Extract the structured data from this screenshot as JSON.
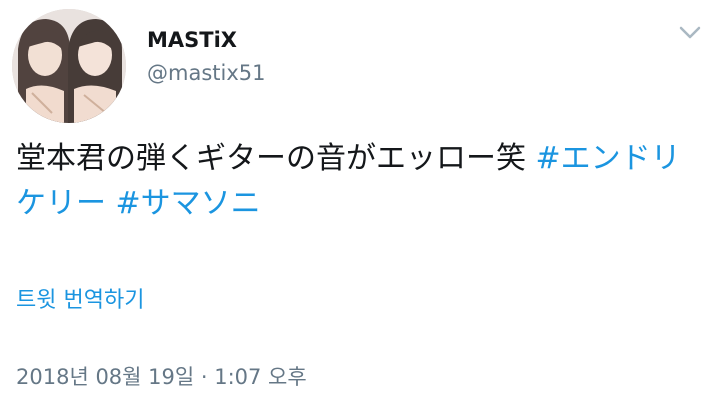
{
  "tweet": {
    "author": {
      "display_name": "MASTiX",
      "handle": "@mastix51"
    },
    "text_plain": "堂本君の弾くギターの音がエッロー笑 ",
    "hashtags": [
      "#エンドリケリー",
      "#サマソニ"
    ],
    "translate_label": "트윗 번역하기",
    "timestamp": "2018년 08월 19일 · 1:07 오후"
  },
  "icons": {
    "menu": "chevron-down-icon",
    "avatar": "profile-photo"
  },
  "colors": {
    "link": "#1b95e0",
    "secondary_text": "#657786",
    "primary_text": "#14171a"
  }
}
